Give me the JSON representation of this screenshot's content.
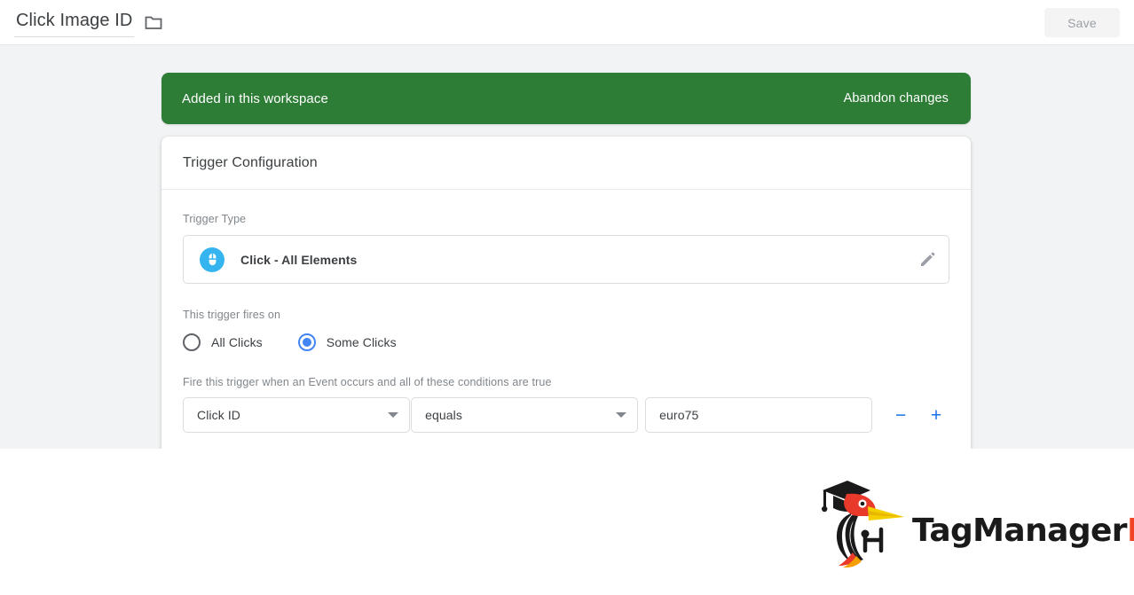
{
  "topbar": {
    "title": "Click Image ID",
    "folder_icon": "folder-icon",
    "save_label": "Save",
    "save_enabled": false
  },
  "banner": {
    "message": "Added in this workspace",
    "action_label": "Abandon changes",
    "background_color": "#2e7d36",
    "text_color": "#ffffff"
  },
  "card": {
    "header_title": "Trigger Configuration",
    "trigger_type": {
      "label": "Trigger Type",
      "icon": "mouse-click-icon",
      "icon_color": "#35b4f0",
      "name": "Click - All Elements",
      "edit_icon": "pencil-icon"
    },
    "fires_on": {
      "label": "This trigger fires on",
      "options": [
        {
          "label": "All Clicks",
          "selected": false
        },
        {
          "label": "Some Clicks",
          "selected": true
        }
      ],
      "selected_color": "#4285f4"
    },
    "conditions": {
      "label": "Fire this trigger when an Event occurs and all of these conditions are true",
      "rows": [
        {
          "variable": "Click ID",
          "operator": "equals",
          "value": "euro75",
          "value_placeholder": "",
          "remove_label": "−",
          "add_label": "+"
        }
      ],
      "button_color": "#1a73e8"
    }
  },
  "logo": {
    "icon": "woodpecker-graduate-icon",
    "text_primary": "TagManager",
    "text_accent": "Italia",
    "primary_color": "#1a1a1a",
    "accent_color": "#f04323"
  }
}
